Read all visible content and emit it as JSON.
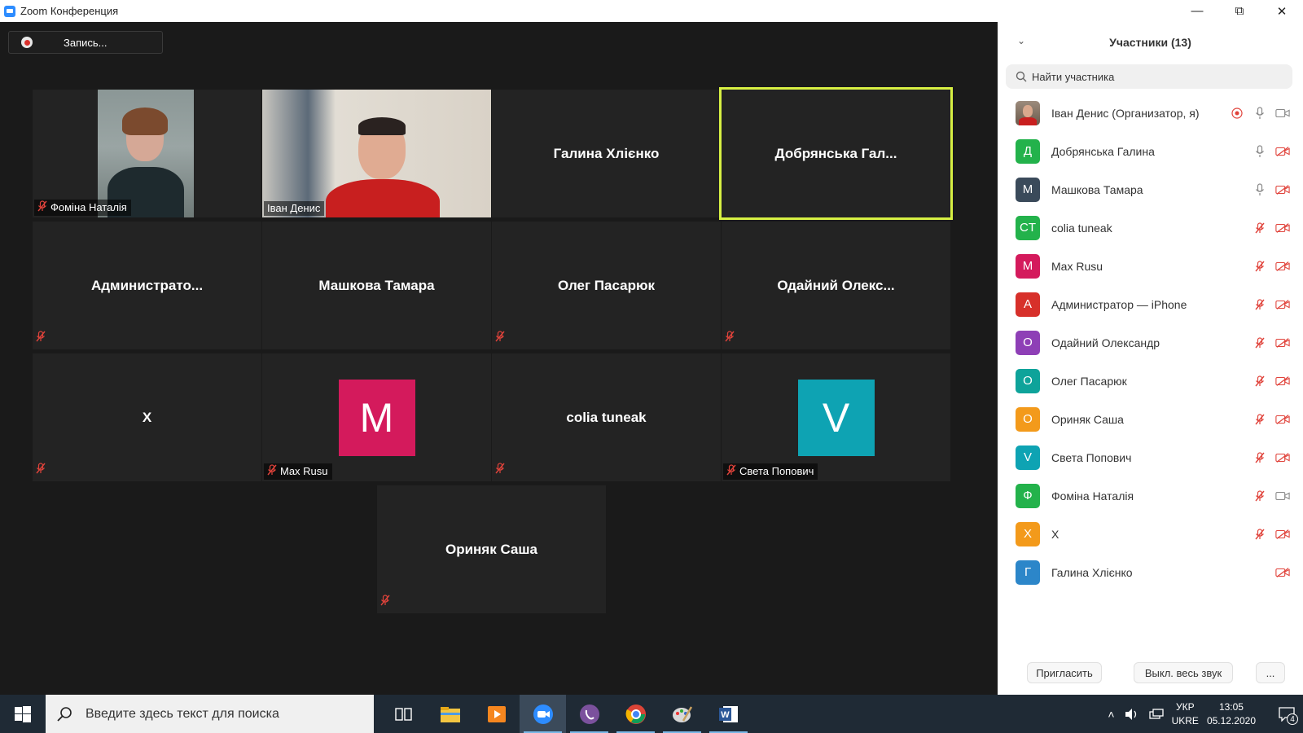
{
  "window": {
    "title": "Zoom Конференция"
  },
  "recording": {
    "label": "Запись..."
  },
  "tiles": [
    {
      "name": "Фоміна Наталія",
      "type": "video-woman",
      "muted": true
    },
    {
      "name": "Іван Денис",
      "type": "video-man",
      "muted": false
    },
    {
      "name": "Галина Хлієнко",
      "type": "name",
      "muted": false
    },
    {
      "name": "Добрянська Гал...",
      "type": "name",
      "muted": false,
      "active": true
    },
    {
      "name": "Администрато...",
      "type": "name",
      "muted": true
    },
    {
      "name": "Машкова Тамара",
      "type": "name",
      "muted": false
    },
    {
      "name": "Олег Пасарюк",
      "type": "name",
      "muted": true
    },
    {
      "name": "Одайний Олекс...",
      "type": "name",
      "muted": true
    },
    {
      "name": "X",
      "type": "name",
      "muted": true
    },
    {
      "name": "Max Rusu",
      "type": "avatar",
      "letter": "M",
      "color": "#d41a5c",
      "muted": true
    },
    {
      "name": "colia tuneak",
      "type": "name",
      "muted": true
    },
    {
      "name": "Света Попович",
      "type": "avatar",
      "letter": "V",
      "color": "#0ea3b3",
      "muted": true
    },
    {
      "name": "Ориняк Саша",
      "type": "name",
      "muted": true
    }
  ],
  "panel": {
    "title": "Участники (13)",
    "search_placeholder": "Найти участника",
    "participants": [
      {
        "name": "Іван Денис (Организатор, я)",
        "avatar": "photo",
        "color": "#8a7a6a",
        "rec": true,
        "mic": "on",
        "cam": "on"
      },
      {
        "name": "Добрянська Галина",
        "avatar": "Д",
        "color": "#23b24b",
        "mic": "on",
        "cam": "off"
      },
      {
        "name": "Машкова Тамара",
        "avatar": "M",
        "color": "#3a4a5a",
        "mic": "on",
        "cam": "off"
      },
      {
        "name": "colia tuneak",
        "avatar": "CT",
        "color": "#23b24b",
        "mic": "off",
        "cam": "off"
      },
      {
        "name": "Max Rusu",
        "avatar": "M",
        "color": "#d41a5c",
        "mic": "off",
        "cam": "off"
      },
      {
        "name": "Администратор — iPhone",
        "avatar": "A",
        "color": "#d7302a",
        "mic": "off",
        "cam": "off"
      },
      {
        "name": "Одайний Олександр",
        "avatar": "O",
        "color": "#8e3fb6",
        "mic": "off",
        "cam": "off"
      },
      {
        "name": "Олег Пасарюк",
        "avatar": "O",
        "color": "#0ea39a",
        "mic": "off",
        "cam": "off"
      },
      {
        "name": "Ориняк Саша",
        "avatar": "O",
        "color": "#f39a1b",
        "mic": "off",
        "cam": "off"
      },
      {
        "name": "Света Попович",
        "avatar": "V",
        "color": "#0ea3b3",
        "mic": "off",
        "cam": "off"
      },
      {
        "name": "Фоміна Наталія",
        "avatar": "Ф",
        "color": "#23b24b",
        "mic": "off",
        "cam": "on"
      },
      {
        "name": "X",
        "avatar": "X",
        "color": "#f39a1b",
        "mic": "off",
        "cam": "off"
      },
      {
        "name": "Галина Хлієнко",
        "avatar": "Г",
        "color": "#2c86c9",
        "mic": "none",
        "cam": "off"
      }
    ],
    "invite_label": "Пригласить",
    "mute_all_label": "Выкл. весь звук",
    "more_label": "..."
  },
  "taskbar": {
    "search_placeholder": "Введите здесь текст для поиска",
    "lang_top": "УКР",
    "lang_bottom": "UKRE",
    "time": "13:05",
    "date": "05.12.2020",
    "notification_count": "4"
  }
}
